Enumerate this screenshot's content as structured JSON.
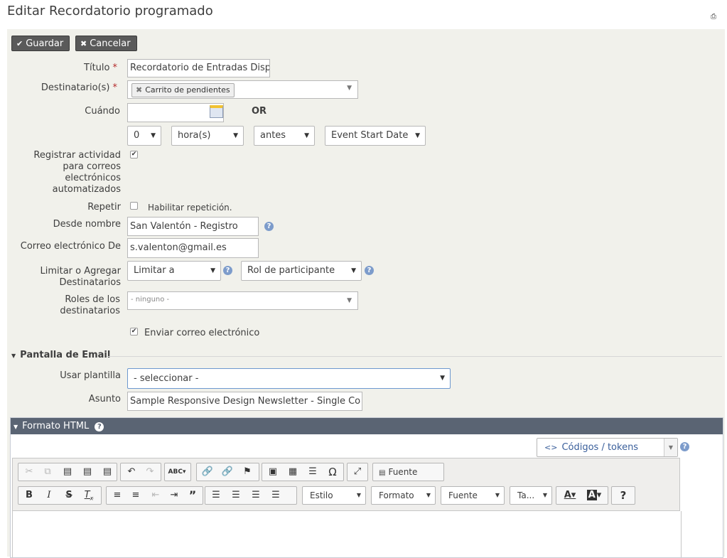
{
  "page": {
    "title": "Editar Recordatorio programado"
  },
  "toolbar": {
    "save_label": "Guardar",
    "cancel_label": "Cancelar"
  },
  "form": {
    "title_label": "Título",
    "title_value": "Recordatorio de Entradas Disp",
    "recipients_label": "Destinatario(s)",
    "recipient_tag": "Carrito de pendientes",
    "when_label": "Cuándo",
    "or_label": "OR",
    "offset_value": "0",
    "unit_value": "hora(s)",
    "relation_value": "antes",
    "event_value": "Event Start Date",
    "log_activity_label": "Registrar actividad para correos electrónicos automatizados",
    "repeat_label": "Repetir",
    "repeat_option": "Habilitar repetición.",
    "from_name_label": "Desde nombre",
    "from_name_value": "San Valentón - Registro",
    "from_email_label": "Correo electrónico De",
    "from_email_value": "s.valenton@gmail.es",
    "limit_label": "Limitar o Agregar Destinatarios",
    "limit_value": "Limitar a",
    "role_value": "Rol de participante",
    "roles_label": "Roles de los destinatarios",
    "roles_value": "- ninguno -",
    "send_email_label": "Enviar correo electrónico"
  },
  "email_section": {
    "header": "Pantalla de Email",
    "template_label": "Usar plantilla",
    "template_value": "- seleccionar -",
    "subject_label": "Asunto",
    "subject_value": "Sample Responsive Design Newsletter - Single Co"
  },
  "html_editor": {
    "header": "Formato HTML",
    "tokens_label": "Códigos / tokens",
    "source_label": "Fuente HTML",
    "style_combo": "Estilo",
    "format_combo": "Formato",
    "font_combo": "Fuente",
    "size_combo": "Ta...",
    "help_label": "?"
  }
}
